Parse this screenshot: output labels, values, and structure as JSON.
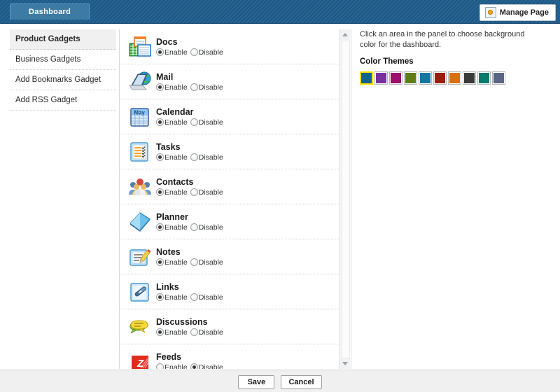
{
  "header": {
    "tabs": [
      {
        "label": "Dashboard",
        "active": true
      }
    ],
    "manage_page": {
      "label": "Manage Page",
      "icon": "gear-page-icon"
    },
    "background_color": "#1e5c8c"
  },
  "sidebar": {
    "items": [
      {
        "label": "Product Gadgets",
        "active": true
      },
      {
        "label": "Business Gadgets",
        "active": false
      },
      {
        "label": "Add Bookmarks Gadget",
        "active": false
      },
      {
        "label": "Add RSS Gadget",
        "active": false
      }
    ]
  },
  "gadget_list": {
    "enable_label": "Enable",
    "disable_label": "Disable",
    "items": [
      {
        "name": "Docs",
        "icon": "docs-icon",
        "state": "enable"
      },
      {
        "name": "Mail",
        "icon": "mail-icon",
        "state": "enable"
      },
      {
        "name": "Calendar",
        "icon": "calendar-icon",
        "state": "enable",
        "icon_text": "May"
      },
      {
        "name": "Tasks",
        "icon": "tasks-icon",
        "state": "enable"
      },
      {
        "name": "Contacts",
        "icon": "contacts-icon",
        "state": "enable"
      },
      {
        "name": "Planner",
        "icon": "planner-icon",
        "state": "enable"
      },
      {
        "name": "Notes",
        "icon": "notes-icon",
        "state": "enable"
      },
      {
        "name": "Links",
        "icon": "links-icon",
        "state": "enable"
      },
      {
        "name": "Discussions",
        "icon": "discussions-icon",
        "state": "enable"
      },
      {
        "name": "Feeds",
        "icon": "feeds-icon",
        "state": "disable",
        "icon_text": "Z"
      }
    ]
  },
  "theme_panel": {
    "help_text": "Click an area in the panel to choose background color for the dashboard.",
    "heading": "Color Themes",
    "selected_index": 0,
    "selection_outline": "#ffe000",
    "swatches": [
      {
        "name": "steel-blue",
        "color": "#10628f"
      },
      {
        "name": "purple",
        "color": "#7a2f9e"
      },
      {
        "name": "magenta",
        "color": "#9c0f6b"
      },
      {
        "name": "olive-green",
        "color": "#5f7c14"
      },
      {
        "name": "teal-blue",
        "color": "#1477a0"
      },
      {
        "name": "dark-red",
        "color": "#9c1d10"
      },
      {
        "name": "orange",
        "color": "#d9700f"
      },
      {
        "name": "charcoal",
        "color": "#3a3a3a"
      },
      {
        "name": "teal-green",
        "color": "#067a6b"
      },
      {
        "name": "slate-blue",
        "color": "#5b6585"
      }
    ]
  },
  "footer": {
    "save_label": "Save",
    "cancel_label": "Cancel"
  },
  "scrollbar": {
    "up_arrow": "scroll-up-arrow",
    "down_arrow": "scroll-down-arrow"
  }
}
